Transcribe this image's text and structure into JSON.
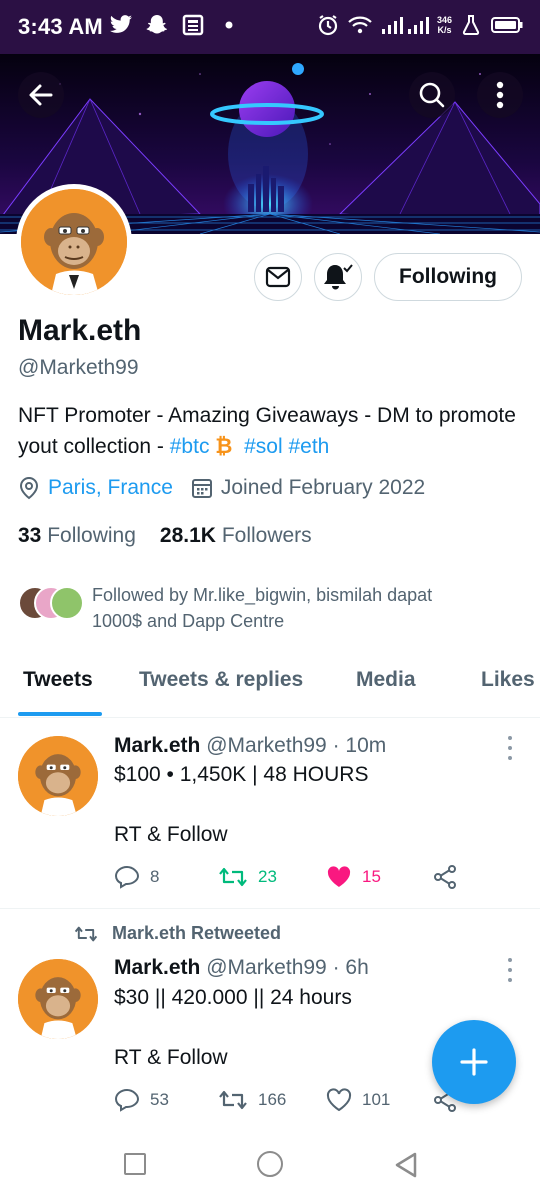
{
  "status_bar": {
    "time": "3:43 AM",
    "speed_value": "346",
    "speed_unit": "K/s",
    "icons": [
      "twitter-icon",
      "snapchat-icon",
      "news-icon",
      "dot-icon",
      "alarm-icon",
      "wifi-icon",
      "signal-icon",
      "lab-icon",
      "battery-icon"
    ]
  },
  "profile": {
    "name": "Mark.eth",
    "handle": "@Marketh99",
    "bio_text": "NFT Promoter - Amazing Giveaways - DM to promote yout collection - ",
    "bio_tag_btc": "#btc",
    "bio_btc_symbol": "₿",
    "bio_tag_sol": "#sol",
    "bio_tag_eth": "#eth",
    "location": "Paris, France",
    "joined": "Joined February 2022",
    "following_count": "33",
    "following_label": "Following",
    "followers_count": "28.1K",
    "followers_label": "Followers",
    "followed_by": "Followed by Mr.like_bigwin, bismilah dapat 1000$ and Dapp Centre",
    "following_button": "Following"
  },
  "tabs": [
    {
      "label": "Tweets",
      "active": true
    },
    {
      "label": "Tweets & replies",
      "active": false
    },
    {
      "label": "Media",
      "active": false
    },
    {
      "label": "Likes",
      "active": false
    }
  ],
  "tweets": [
    {
      "name": "Mark.eth",
      "handle": "@Marketh99",
      "time": "· 10m",
      "line1": "$100 • 1,450K | 48 HOURS",
      "line2": "RT & Follow",
      "replies": "8",
      "retweets": "23",
      "likes": "15",
      "liked": true,
      "retweeted_label": ""
    },
    {
      "name": "Mark.eth",
      "handle": "@Marketh99",
      "time": "· 6h",
      "line1": "$30 || 420.000 || 24 hours",
      "line2": "RT & Follow",
      "replies": "53",
      "retweets": "166",
      "likes": "101",
      "liked": false,
      "retweeted_label": "Mark.eth Retweeted"
    }
  ],
  "colors": {
    "accent": "#1d9bf0",
    "retweet_green": "#00ba7c",
    "like_pink": "#f91880",
    "status_bar_bg": "#2b1044",
    "avatar_bg": "#f0932b"
  }
}
